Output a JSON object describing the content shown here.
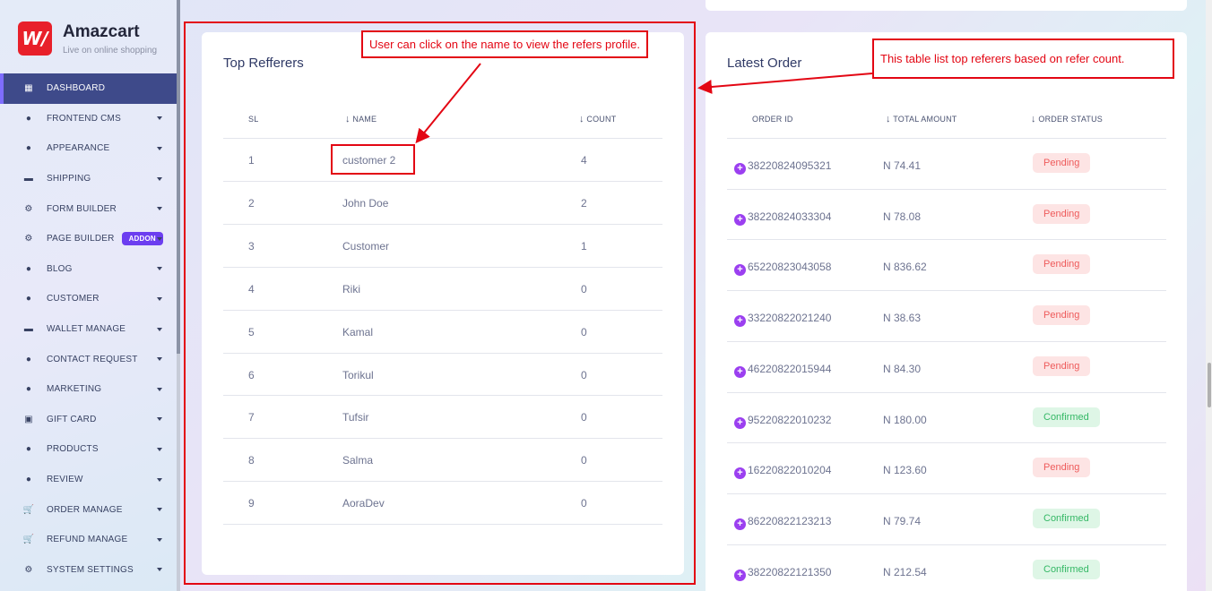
{
  "brand": {
    "name": "Amazcart",
    "tagline": "Live on online shopping",
    "logo_glyph": "W/"
  },
  "sidebar": {
    "items": [
      {
        "label": "DASHBOARD",
        "icon": "grid-icon",
        "glyph": "▦",
        "active": true
      },
      {
        "label": "FRONTEND CMS",
        "icon": "user-icon",
        "glyph": "●"
      },
      {
        "label": "APPEARANCE",
        "icon": "user-icon",
        "glyph": "●"
      },
      {
        "label": "SHIPPING",
        "icon": "truck-icon",
        "glyph": "▬"
      },
      {
        "label": "FORM BUILDER",
        "icon": "cogs-icon",
        "glyph": "⚙"
      },
      {
        "label": "PAGE BUILDER",
        "icon": "cogs-icon",
        "glyph": "⚙",
        "badge": "ADDON"
      },
      {
        "label": "BLOG",
        "icon": "users-icon",
        "glyph": "●"
      },
      {
        "label": "CUSTOMER",
        "icon": "users-icon",
        "glyph": "●"
      },
      {
        "label": "WALLET MANAGE",
        "icon": "wallet-icon",
        "glyph": "▬"
      },
      {
        "label": "CONTACT REQUEST",
        "icon": "user-icon",
        "glyph": "●"
      },
      {
        "label": "MARKETING",
        "icon": "user-icon",
        "glyph": "●"
      },
      {
        "label": "GIFT CARD",
        "icon": "gift-icon",
        "glyph": "▣"
      },
      {
        "label": "PRODUCTS",
        "icon": "product-icon",
        "glyph": "●"
      },
      {
        "label": "REVIEW",
        "icon": "user-icon",
        "glyph": "●"
      },
      {
        "label": "ORDER MANAGE",
        "icon": "cart-icon",
        "glyph": "🛒"
      },
      {
        "label": "REFUND MANAGE",
        "icon": "cart-icon",
        "glyph": "🛒"
      },
      {
        "label": "SYSTEM SETTINGS",
        "icon": "gear-icon",
        "glyph": "⚙"
      }
    ]
  },
  "referrers": {
    "title": "Top Refferers",
    "headers": {
      "sl": "SL",
      "name": "NAME",
      "count": "COUNT",
      "sort_glyph": "↓"
    },
    "rows": [
      {
        "sl": "1",
        "name": "customer 2",
        "count": "4"
      },
      {
        "sl": "2",
        "name": "John Doe",
        "count": "2"
      },
      {
        "sl": "3",
        "name": "Customer",
        "count": "1"
      },
      {
        "sl": "4",
        "name": "Riki",
        "count": "0"
      },
      {
        "sl": "5",
        "name": "Kamal",
        "count": "0"
      },
      {
        "sl": "6",
        "name": "Torikul",
        "count": "0"
      },
      {
        "sl": "7",
        "name": "Tufsir",
        "count": "0"
      },
      {
        "sl": "8",
        "name": "Salma",
        "count": "0"
      },
      {
        "sl": "9",
        "name": "AoraDev",
        "count": "0"
      }
    ]
  },
  "orders": {
    "title": "Latest Order",
    "headers": {
      "id": "ORDER ID",
      "amount": "TOTAL AMOUNT",
      "status": "ORDER STATUS",
      "sort_glyph": "↓"
    },
    "plus_glyph": "+",
    "rows": [
      {
        "id": "38220824095321",
        "amount": "N 74.41",
        "status": "Pending"
      },
      {
        "id": "38220824033304",
        "amount": "N 78.08",
        "status": "Pending"
      },
      {
        "id": "65220823043058",
        "amount": "N 836.62",
        "status": "Pending"
      },
      {
        "id": "33220822021240",
        "amount": "N 38.63",
        "status": "Pending"
      },
      {
        "id": "46220822015944",
        "amount": "N 84.30",
        "status": "Pending"
      },
      {
        "id": "95220822010232",
        "amount": "N 180.00",
        "status": "Confirmed"
      },
      {
        "id": "16220822010204",
        "amount": "N 123.60",
        "status": "Pending"
      },
      {
        "id": "86220822123213",
        "amount": "N 79.74",
        "status": "Confirmed"
      },
      {
        "id": "38220822121350",
        "amount": "N 212.54",
        "status": "Confirmed"
      }
    ]
  },
  "annotations": {
    "name_click": "User can click on the name to view the refers profile.",
    "table_list": "This table list top referers based on refer count."
  },
  "colors": {
    "accent": "#3e4a8a",
    "annotation": "#e30613",
    "pending": "#ee5b5b",
    "confirmed": "#35b866",
    "plus": "#9b3ff0"
  }
}
